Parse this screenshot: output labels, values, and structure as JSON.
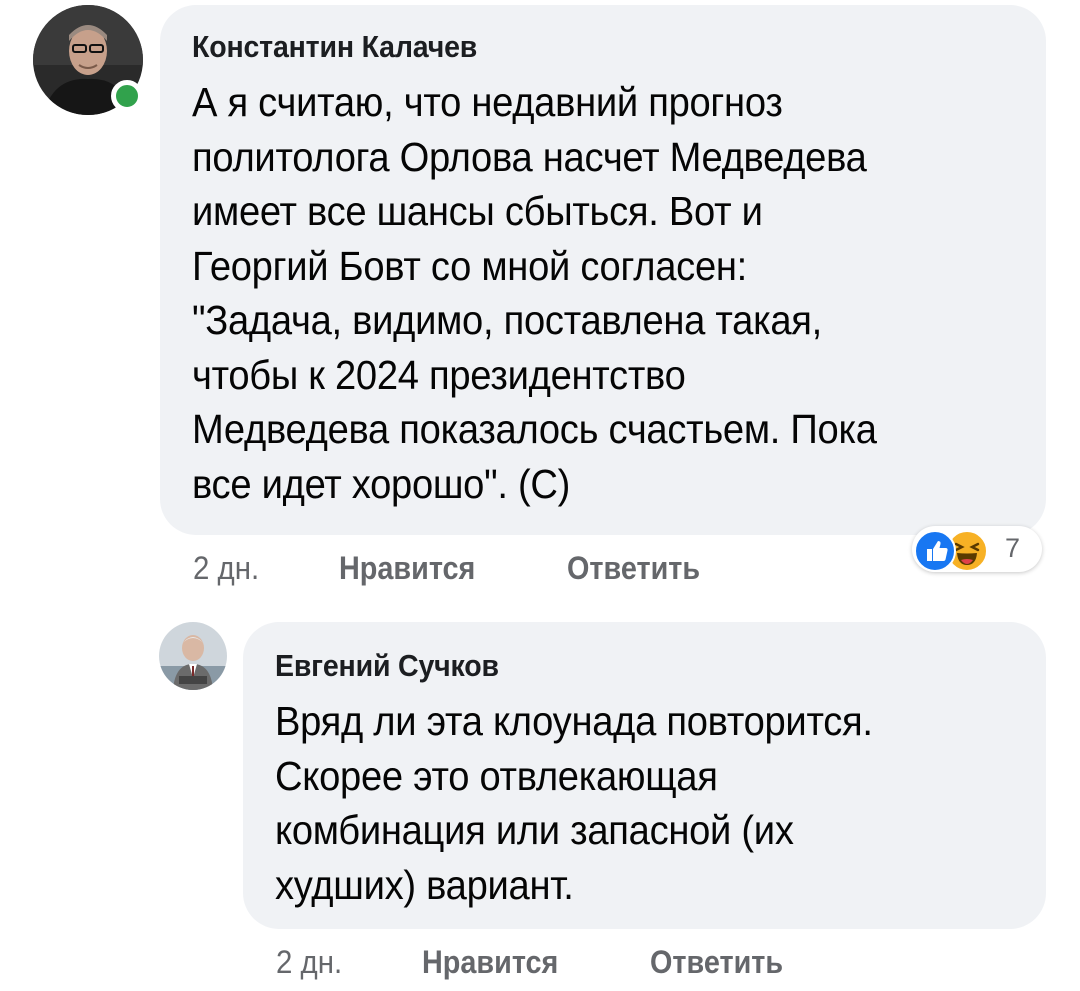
{
  "comments": [
    {
      "author": "Константин Калачев",
      "online": true,
      "text_lines": [
        "А я считаю, что недавний прогноз",
        "политолога Орлова насчет Медведева",
        "имеет все шансы сбыться.  Вот и",
        "Георгий Бовт со мной согласен:",
        "\"Задача, видимо, поставлена такая,",
        "чтобы к 2024 президентство",
        "Медведева показалось счастьем. Пока",
        "все идет хорошо\". (С)"
      ],
      "time": "2 дн.",
      "like_label": "Нравится",
      "reply_label": "Ответить",
      "reactions": {
        "icons": [
          "like-icon",
          "haha-icon"
        ],
        "count": "7"
      }
    },
    {
      "author": "Евгений Сучков",
      "text_lines": [
        "Вряд ли эта клоунада повторится.",
        "Скорее это отвлекающая",
        "комбинация или запасной (их",
        "худших) вариант."
      ],
      "time": "2 дн.",
      "like_label": "Нравится",
      "reply_label": "Ответить"
    }
  ],
  "colors": {
    "bubble_bg": "#f0f2f5",
    "meta_text": "#65676b",
    "online": "#31a24c",
    "like_blue": "#1877f2",
    "haha_yellow": "#f7b125"
  }
}
